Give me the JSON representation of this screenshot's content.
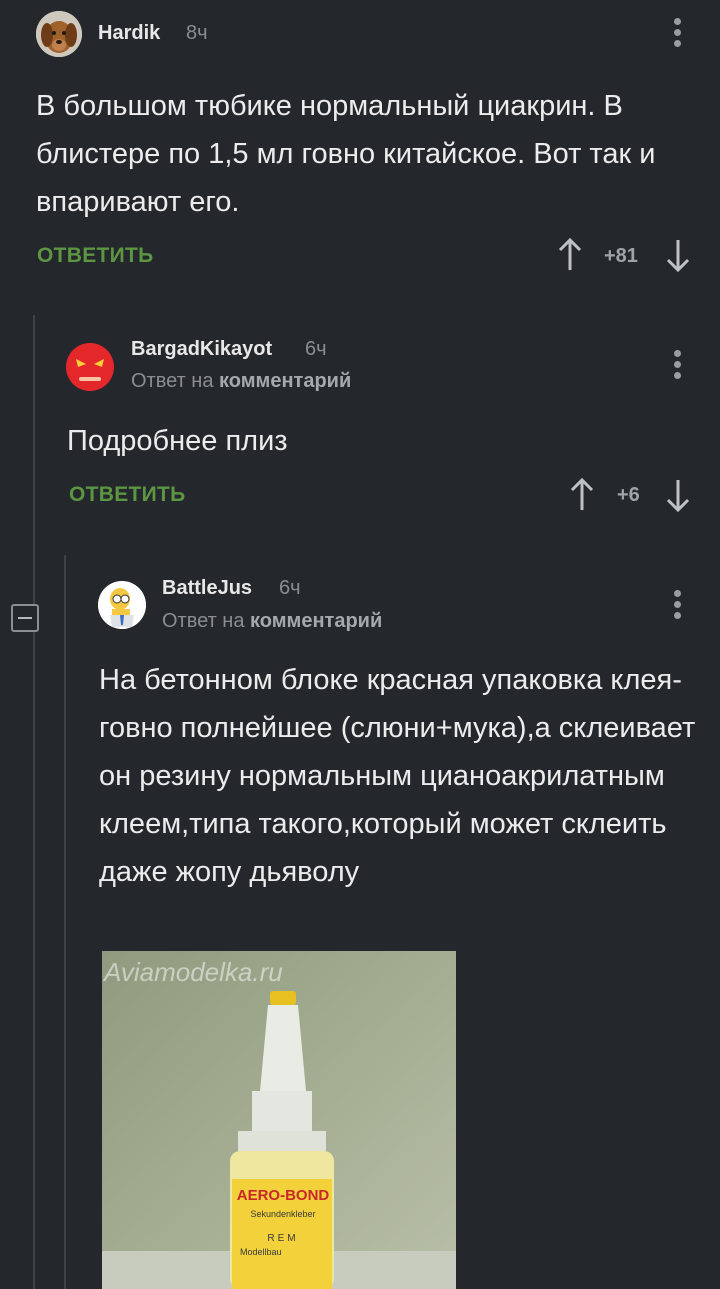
{
  "comments": [
    {
      "username": "Hardik",
      "time": "8ч",
      "text": "В большом тюбике нормальный циакрин. В блистере по 1,5 мл говно китайское. Вот так и впаривают его.",
      "reply_label": "ОТВЕТИТЬ",
      "rating": "+81"
    },
    {
      "username": "BargadKikayot",
      "time": "6ч",
      "reply_prefix": "Ответ на",
      "reply_target": "комментарий",
      "text": "Подробнее плиз",
      "reply_label": "ОТВЕТИТЬ",
      "rating": "+6"
    },
    {
      "username": "BattleJus",
      "time": "6ч",
      "reply_prefix": "Ответ на",
      "reply_target": "комментарий",
      "text": "На бетонном блоке красная упаковка клея-говно полнейшее (слюни+мука),а склеивает он резину нормальным цианоакрилатным клеем,типа такого,который может склеить даже жопу дьяволу",
      "image": {
        "watermark": "Aviamodelka.ru",
        "label_brand": "AERO-BOND",
        "label_sub": "Sekundenkleber",
        "label_maker": "REM",
        "label_line1": "Modellbau"
      }
    }
  ],
  "colors": {
    "background": "#24272b",
    "reply_green": "#5d9643",
    "meta_gray": "#8a8d91",
    "thread_line": "#3e4247"
  }
}
